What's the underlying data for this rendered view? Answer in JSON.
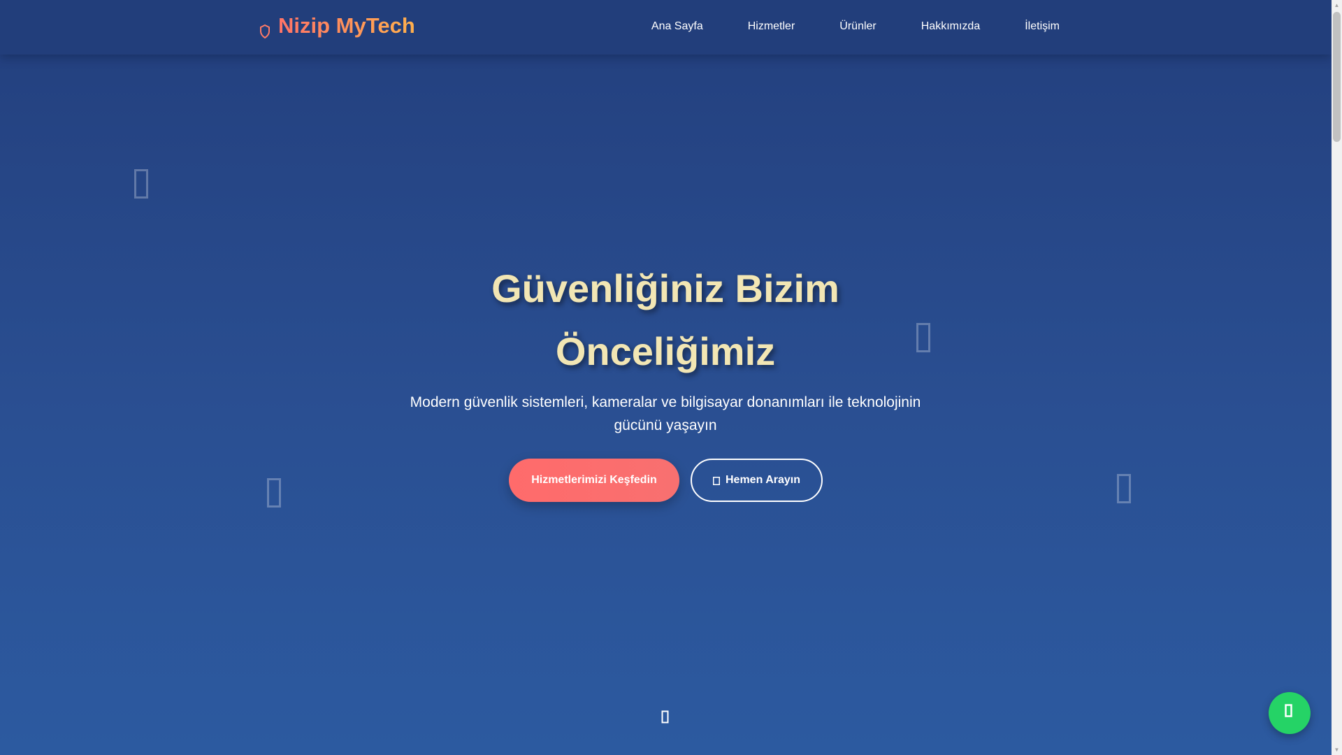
{
  "header": {
    "logo_text": "Nizip MyTech",
    "logo_icon": "shield-icon",
    "nav": [
      {
        "label": "Ana Sayfa"
      },
      {
        "label": "Hizmetler"
      },
      {
        "label": "Ürünler"
      },
      {
        "label": "Hakkımızda"
      },
      {
        "label": "İletişim"
      }
    ]
  },
  "hero": {
    "title_line1": "Güvenliğiniz Bizim",
    "title_line2": "Önceliğimiz",
    "subtitle_line1": "Modern güvenlik sistemleri, kameralar ve bilgisayar donanımları ile teknolojinin",
    "subtitle_line2": "gücünü yaşayın",
    "primary_button": "Hizmetlerimizi Keşfedin",
    "secondary_button": "Hemen Arayın",
    "secondary_button_icon": "phone-icon"
  },
  "decor_icons": [
    "floating-icon",
    "floating-icon",
    "floating-icon",
    "floating-icon"
  ],
  "scroll_icon": "scroll-down-icon",
  "whatsapp_icon": "whatsapp-icon",
  "colors": {
    "background_top": "#233f7d",
    "background_bottom": "#2c5aa0",
    "accent": "#ff6b6b",
    "accent_alt": "#ffb04d",
    "title": "#f2e6b4",
    "whatsapp": "#25d366"
  }
}
